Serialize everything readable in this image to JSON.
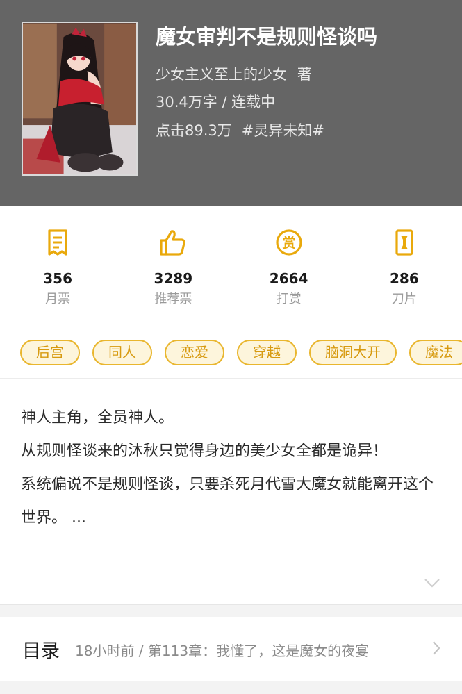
{
  "book": {
    "title": "魔女审判不是规则怪谈吗",
    "author": "少女主义至上的少女",
    "author_suffix": "著",
    "words_status": "30.4万字 / 连载中",
    "clicks": "点击89.3万",
    "genre": "#灵异未知#",
    "cover_icon": "anime-girl-cover"
  },
  "stats": [
    {
      "icon": "monthly-ticket-icon",
      "value": "356",
      "label": "月票"
    },
    {
      "icon": "thumbs-up-icon",
      "value": "3289",
      "label": "推荐票"
    },
    {
      "icon": "reward-coin-icon",
      "value": "2664",
      "label": "打赏"
    },
    {
      "icon": "blade-icon",
      "value": "286",
      "label": "刀片"
    }
  ],
  "tags": [
    "后宫",
    "同人",
    "恋爱",
    "穿越",
    "脑洞大开",
    "魔法"
  ],
  "description": {
    "lines": [
      "神人主角，全员神人。",
      "从规则怪谈来的沐秋只觉得身边的美少女全都是诡异！",
      "系统偏说不是规则怪谈，只要杀死月代雪大魔女就能离开这个世界。 ..."
    ],
    "expand_icon": "chevron-down-icon"
  },
  "toc": {
    "label": "目录",
    "latest": "18小时前 / 第113章：我懂了，这是魔女的夜宴",
    "arrow_icon": "chevron-right-icon"
  },
  "colors": {
    "header_bg": "#656565",
    "accent": "#e9b62e",
    "tag_text": "#d79a10",
    "tag_bg": "#fdf5dc"
  }
}
